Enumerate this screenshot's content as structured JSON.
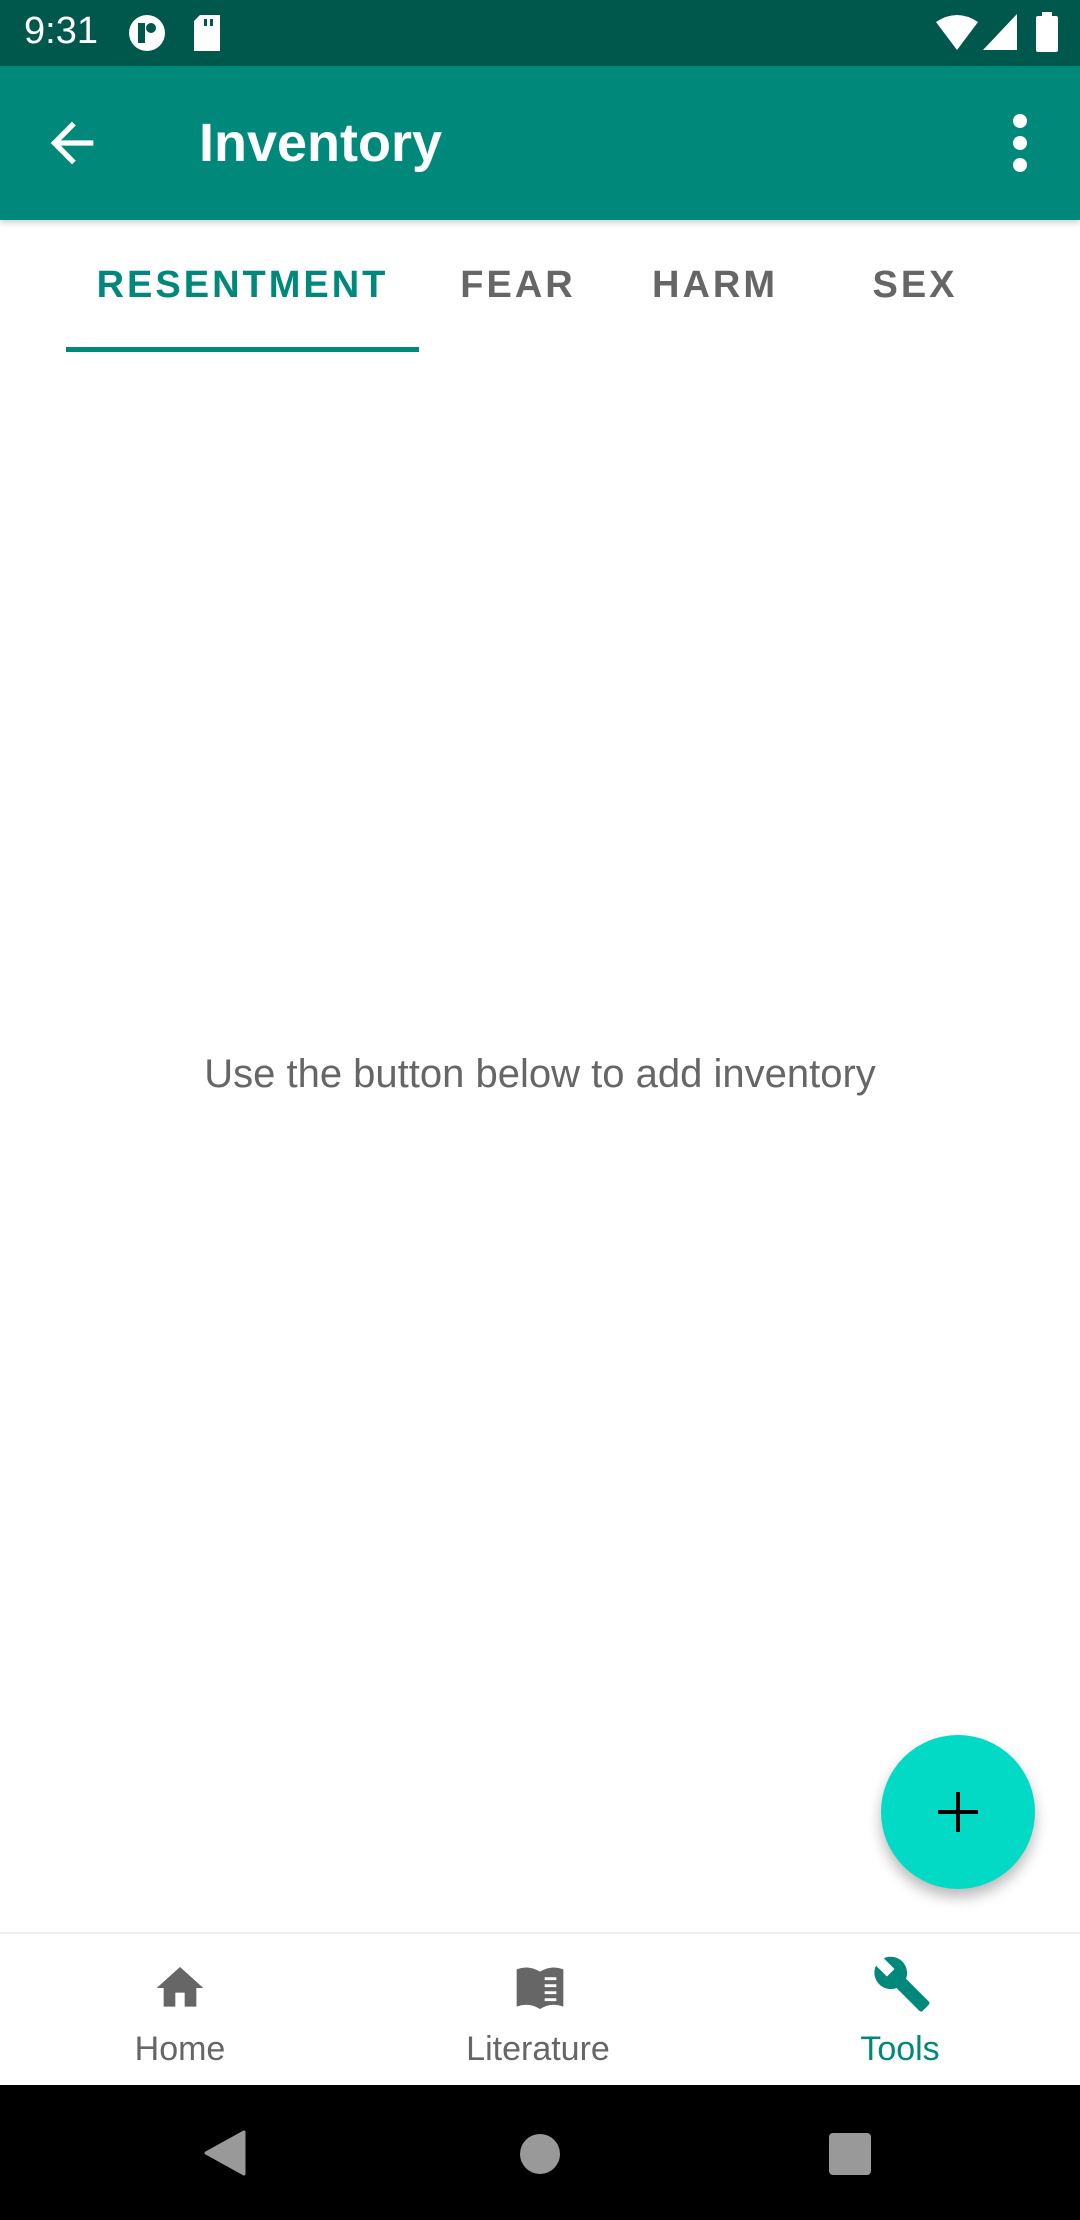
{
  "status_bar": {
    "time": "9:31"
  },
  "app_bar": {
    "title": "Inventory"
  },
  "tabs": [
    {
      "label": "RESENTMENT",
      "active": true
    },
    {
      "label": "FEAR",
      "active": false
    },
    {
      "label": "HARM",
      "active": false
    },
    {
      "label": "SEX",
      "active": false
    }
  ],
  "main": {
    "empty_message": "Use the button below to add inventory"
  },
  "bottom_nav": {
    "items": [
      {
        "label": "Home",
        "icon": "home-icon",
        "active": false
      },
      {
        "label": "Literature",
        "icon": "book-icon",
        "active": false
      },
      {
        "label": "Tools",
        "icon": "wrench-icon",
        "active": true
      }
    ]
  },
  "colors": {
    "primary": "#00897b",
    "primary_dark": "#00574b",
    "accent": "#03dac5"
  }
}
